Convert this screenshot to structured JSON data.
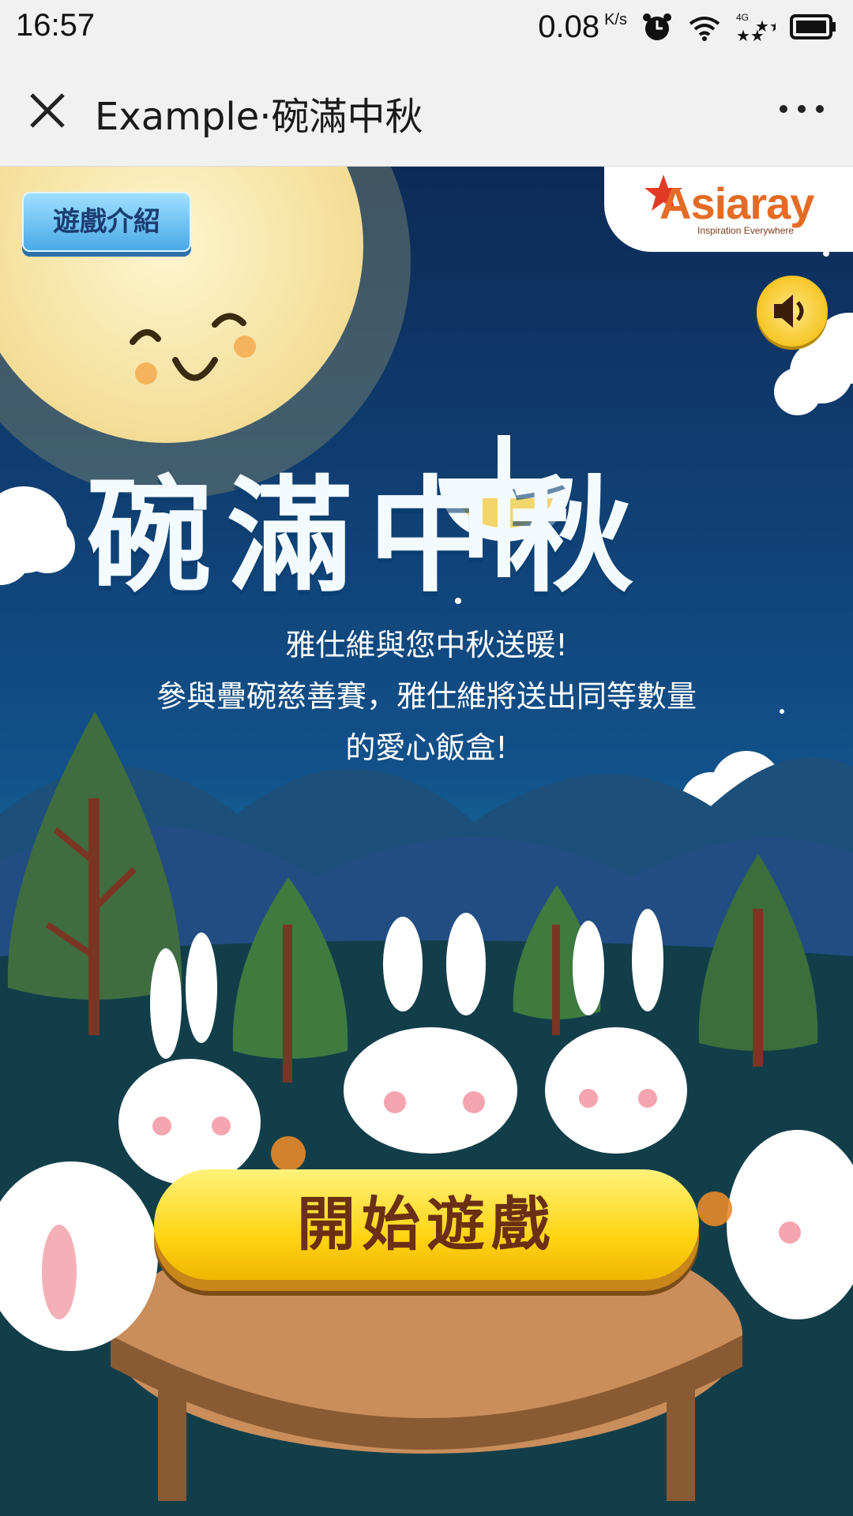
{
  "status": {
    "time": "16:57",
    "speed": "0.08",
    "speed_unit": "K/s",
    "network": "4G"
  },
  "titlebar": {
    "title": "Example·碗滿中秋"
  },
  "game": {
    "intro_button": "遊戲介紹",
    "logo_name": "Asiaray",
    "logo_tagline": "Inspiration Everywhere",
    "title": "碗滿中秋",
    "subtitle_lines": [
      "雅仕維與您中秋送暖!",
      "參與疊碗慈善賽，雅仕維將送出同等數量",
      "的愛心飯盒!"
    ],
    "start_button": "開始遊戲"
  },
  "colors": {
    "sky_top": "#0d2a57",
    "sky_bottom": "#16a0b0",
    "moon": "#f8e9b0",
    "button_yellow": "#ffd514",
    "brand_orange": "#e46b25"
  }
}
